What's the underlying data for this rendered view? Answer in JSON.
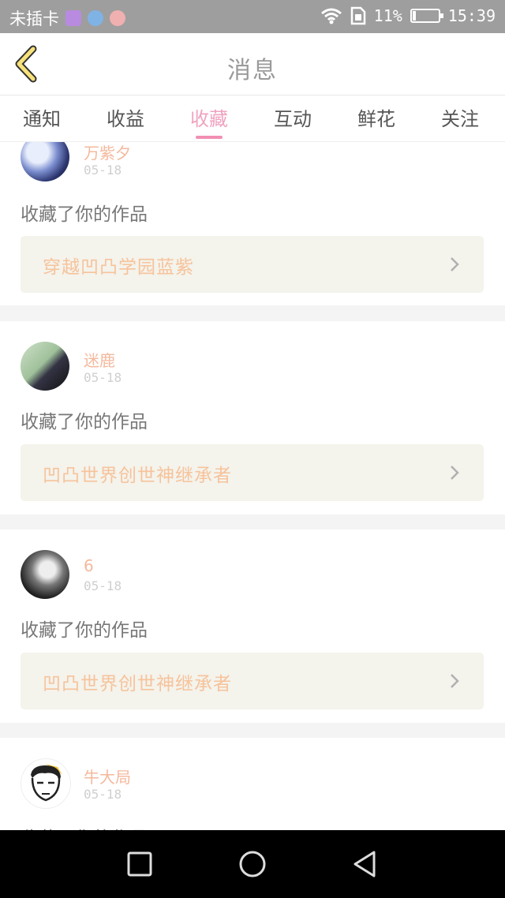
{
  "status_bar": {
    "carrier": "未插卡",
    "battery_text": "11%",
    "battery_level": 0.11,
    "time": "15:39"
  },
  "header": {
    "title": "消息",
    "back_icon": "chevron-left-icon"
  },
  "tabs": [
    {
      "label": "通知",
      "active": false
    },
    {
      "label": "收益",
      "active": false
    },
    {
      "label": "收藏",
      "active": true
    },
    {
      "label": "互动",
      "active": false
    },
    {
      "label": "鲜花",
      "active": false
    },
    {
      "label": "关注",
      "active": false
    }
  ],
  "feed": [
    {
      "user": "万紫夕",
      "date": "05-18",
      "action": "收藏了你的作品",
      "work": "穿越凹凸学园蓝紫"
    },
    {
      "user": "迷鹿",
      "date": "05-18",
      "action": "收藏了你的作品",
      "work": "凹凸世界创世神继承者"
    },
    {
      "user": "6",
      "date": "05-18",
      "action": "收藏了你的作品",
      "work": "凹凸世界创世神继承者"
    },
    {
      "user": "牛大局",
      "date": "05-18",
      "action": "收藏了你的作品",
      "work": ""
    }
  ],
  "colors": {
    "accent_pink": "#f28fb3",
    "username": "#f4b99d",
    "work_title": "#f6c39b",
    "work_bg": "#f4f3ec"
  }
}
